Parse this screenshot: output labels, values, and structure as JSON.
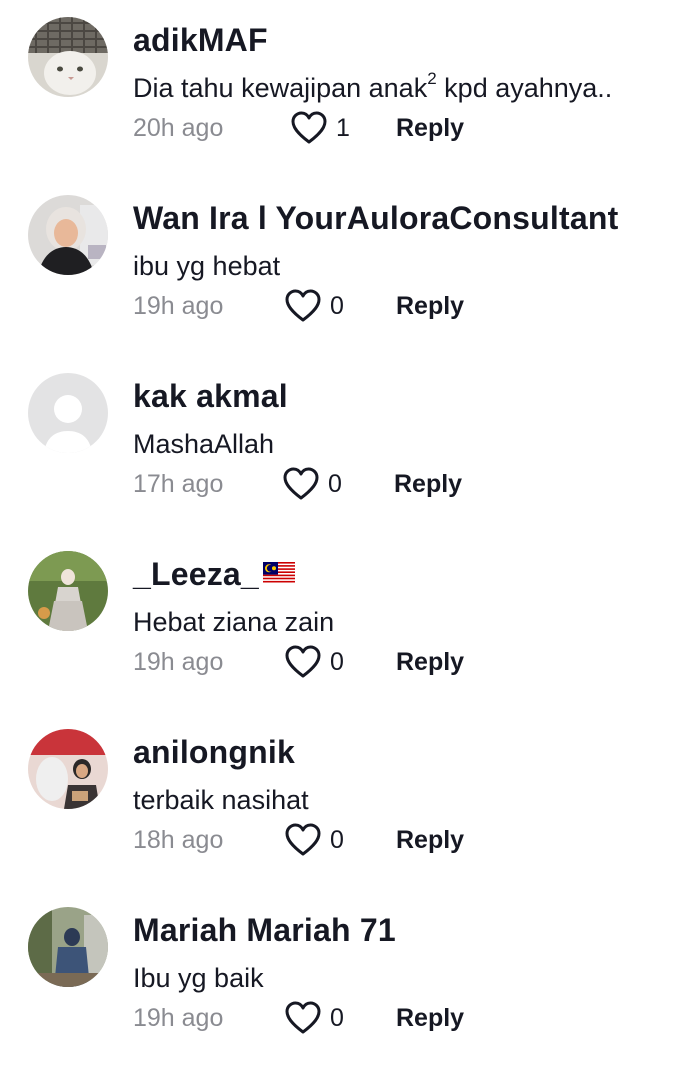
{
  "comments": [
    {
      "username": "adikMAF",
      "text_before": "Dia tahu kewajipan anak",
      "text_sup": "2",
      "text_after": " kpd ayahnya..",
      "time": "20h ago",
      "likes": "1",
      "reply_label": "Reply",
      "avatar_icon": "user-avatar-cat-photo"
    },
    {
      "username": "Wan Ira l YourAuloraConsultant",
      "text": "ibu yg hebat",
      "time": "19h ago",
      "likes": "0",
      "reply_label": "Reply",
      "avatar_icon": "user-avatar-photo"
    },
    {
      "username": "kak akmal",
      "text": "MashaAllah",
      "time": "17h ago",
      "likes": "0",
      "reply_label": "Reply",
      "avatar_icon": "default-avatar-placeholder"
    },
    {
      "username": "_Leeza_",
      "username_flag": "malaysia-flag-emoji",
      "text": "Hebat ziana zain",
      "time": "19h ago",
      "likes": "0",
      "reply_label": "Reply",
      "avatar_icon": "user-avatar-photo"
    },
    {
      "username": "anilongnik",
      "text": "terbaik nasihat",
      "time": "18h ago",
      "likes": "0",
      "reply_label": "Reply",
      "avatar_icon": "user-avatar-photo"
    },
    {
      "username": "Mariah Mariah 71",
      "text": "Ibu yg baik",
      "time": "19h ago",
      "likes": "0",
      "reply_label": "Reply",
      "avatar_icon": "user-avatar-photo"
    }
  ],
  "colors": {
    "text": "#161823",
    "secondary": "#8a8b91",
    "placeholder_avatar": "#e3e3e4"
  }
}
